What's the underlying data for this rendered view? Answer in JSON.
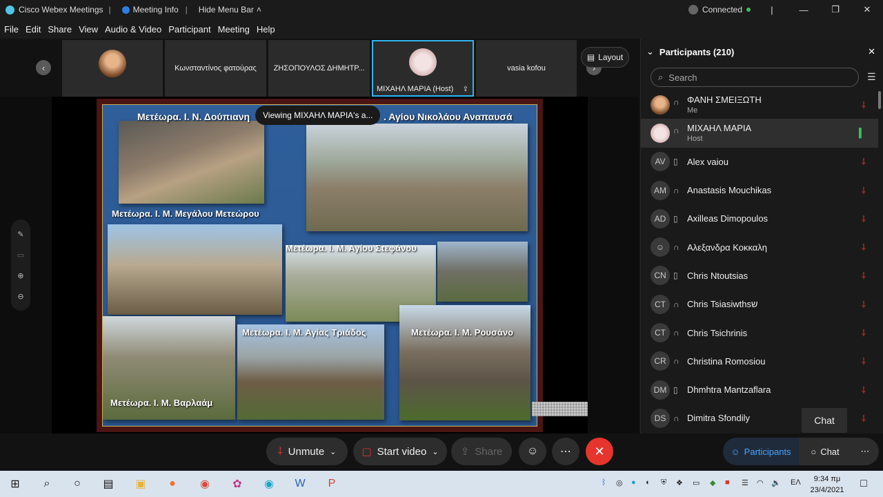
{
  "titlebar": {
    "app_title": "Cisco Webex Meetings",
    "meeting_info": "Meeting Info",
    "hide_menu": "Hide Menu Bar",
    "status": "Connected",
    "status_color": "#3fbf5a"
  },
  "menu": [
    "File",
    "Edit",
    "Share",
    "View",
    "Audio & Video",
    "Participant",
    "Meeting",
    "Help"
  ],
  "strip": {
    "tiles": [
      "",
      "Κωνσταντίνος φατούρας",
      "ΖΗΣΟΠΟΥΛΟΣ ΔΗΜΗΤΡ...",
      "ΜΙΧΑΗΛ ΜΑΡΙΑ  (Host)",
      "vasia kofou"
    ],
    "layout_label": "Layout"
  },
  "slide": {
    "title_left": "Μετέωρα. Ι. Ν. Δούπιανη",
    "title_right": ". Αγίου Νικολάου Αναπαυσά",
    "captions": [
      "Μετέωρα. Ι. Μ. Μεγάλου Μετεώρου",
      "Μετέωρα. Ι. Μ. Αγίου Στεφάνου",
      "Μετέωρα. Ι. Μ. Αγίας Τριάδος",
      "Μετέωρα. Ι. Μ. Ρουσάνο",
      "Μετέωρα. Ι. Μ. Βαρλαάμ"
    ]
  },
  "viewing_label": "Viewing ΜΙΧΑΗΛ ΜΑΡΙΑ's a...",
  "controls": {
    "unmute": "Unmute",
    "start_video": "Start video",
    "share": "Share",
    "participants_tab": "Participants",
    "chat_tab": "Chat",
    "accent": "#4aa3ff",
    "end_color": "#e5352c"
  },
  "panel": {
    "title": "Participants (210)",
    "search_placeholder": "Search",
    "chat_tooltip": "Chat",
    "participants": [
      {
        "initials": "",
        "name": "ΦΑΝΗ ΣΜΕΙΞΩΤΗ",
        "sub": "Me",
        "device": "headset",
        "mic": "muted"
      },
      {
        "initials": "",
        "name": "ΜΙΧΑΗΛ ΜΑΡΙΑ",
        "sub": "Host",
        "device": "headset",
        "mic": "active"
      },
      {
        "initials": "AV",
        "name": "Alex vaiou",
        "sub": "",
        "device": "phone",
        "mic": "muted"
      },
      {
        "initials": "AM",
        "name": "Anastasis Mouchikas",
        "sub": "",
        "device": "headset",
        "mic": "muted"
      },
      {
        "initials": "AD",
        "name": "Axilleas Dimopoulos",
        "sub": "",
        "device": "phone",
        "mic": "muted"
      },
      {
        "initials": "",
        "name": "Αλεξανδρα Κοκκαλη",
        "sub": "",
        "device": "headset",
        "mic": "muted"
      },
      {
        "initials": "CN",
        "name": "Chris Ntoutsias",
        "sub": "",
        "device": "phone",
        "mic": "muted"
      },
      {
        "initials": "CT",
        "name": "Chris Tsiasiwthsש",
        "sub": "",
        "device": "headset",
        "mic": "muted"
      },
      {
        "initials": "CT",
        "name": "Chris Tsichrinis",
        "sub": "",
        "device": "headset",
        "mic": "muted"
      },
      {
        "initials": "CR",
        "name": "Christina Romosiou",
        "sub": "",
        "device": "headset",
        "mic": "muted"
      },
      {
        "initials": "DM",
        "name": "Dhmhtra Mantzaflara",
        "sub": "",
        "device": "phone",
        "mic": "muted"
      },
      {
        "initials": "DS",
        "name": "Dimitra Sfondily",
        "sub": "",
        "device": "headset",
        "mic": "muted"
      }
    ]
  },
  "taskbar": {
    "lang": "ΕΛ",
    "time": "9:34 πμ",
    "date": "23/4/2021"
  }
}
